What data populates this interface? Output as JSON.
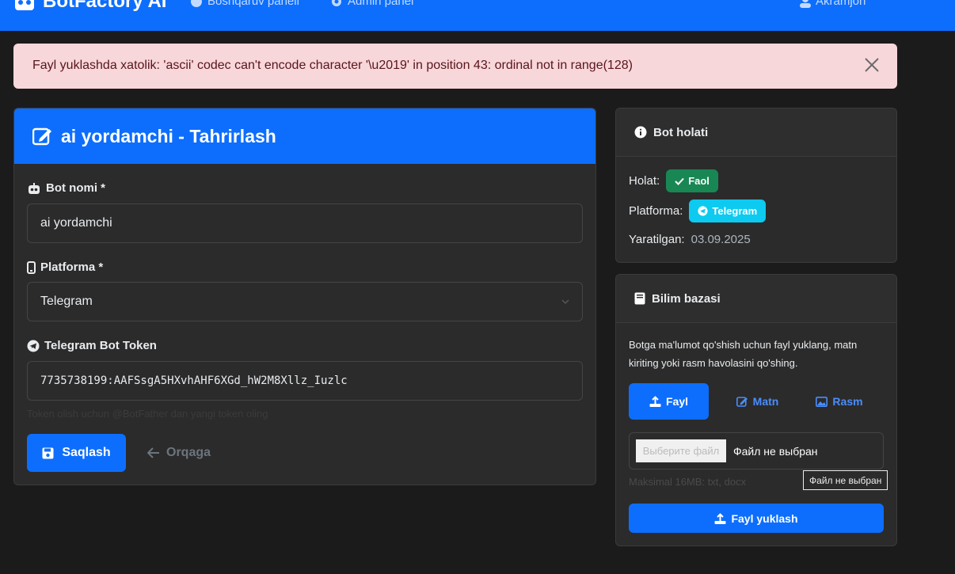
{
  "navbar": {
    "brand": "BotFactory AI",
    "links": [
      "Boshqaruv paneli",
      "Admin panel"
    ],
    "user": "Akramjon"
  },
  "alert": {
    "message": "Fayl yuklashda xatolik: 'ascii' codec can't encode character '\\u2019' in position 43: ordinal not in range(128)"
  },
  "edit": {
    "title": "ai yordamchi - Tahrirlash",
    "name_label": "Bot nomi *",
    "name_value": "ai yordamchi",
    "platform_label": "Platforma *",
    "platform_value": "Telegram",
    "token_label": "Telegram Bot Token",
    "token_value": "7735738199:AAFSsgA5HXvhAHF6XGd_hW2M8Xllz_Iuzlc",
    "token_help": "Token olish uchun @BotFather dan yangi token oling",
    "save_label": "Saqlash",
    "back_label": "Orqaga"
  },
  "status": {
    "title": "Bot holati",
    "state_label": "Holat:",
    "state_value": "Faol",
    "platform_label": "Platforma:",
    "platform_value": "Telegram",
    "created_label": "Yaratilgan:",
    "created_value": "03.09.2025"
  },
  "kb": {
    "title": "Bilim bazasi",
    "description": "Botga ma'lumot qo'shish uchun fayl yuklang, matn kiriting yoki rasm havolasini qo'shing.",
    "tabs": [
      "Fayl",
      "Matn",
      "Rasm"
    ],
    "file_button": "Выберите файл",
    "file_status": "Файл не выбран",
    "max_text": "Maksimal 16MB: txt, docx",
    "tooltip": "Файл не выбран",
    "upload_label": "Fayl yuklash"
  },
  "colors": {
    "primary": "#0d6efd",
    "success": "#198754",
    "info": "#0dcaf0",
    "danger_bg": "#f8d7da",
    "background": "#1b1b1b",
    "card": "#2b2b2b"
  }
}
